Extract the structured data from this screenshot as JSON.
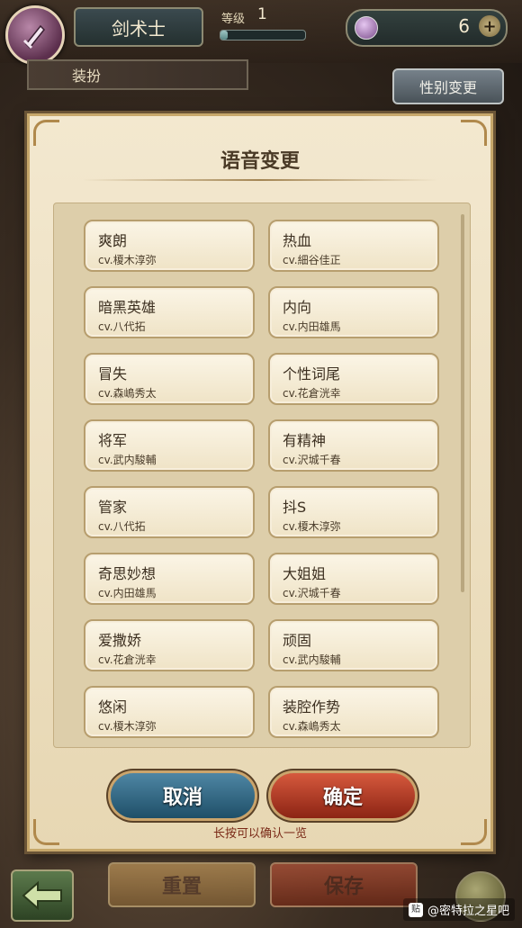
{
  "header": {
    "class_name": "剑术士",
    "level_label": "等级",
    "level_value": "1",
    "level_progress": 0.08,
    "gem_count": "6"
  },
  "outfit_tab": {
    "label": "装扮"
  },
  "gender_button": {
    "label": "性别变更"
  },
  "dialog": {
    "title": "语音变更",
    "voices": [
      {
        "name": "爽朗",
        "cv": "cv.榎木淳弥"
      },
      {
        "name": "热血",
        "cv": "cv.細谷佳正"
      },
      {
        "name": "暗黑英雄",
        "cv": "cv.八代拓"
      },
      {
        "name": "内向",
        "cv": "cv.内田雄馬"
      },
      {
        "name": "冒失",
        "cv": "cv.森嶋秀太"
      },
      {
        "name": "个性词尾",
        "cv": "cv.花倉洸幸"
      },
      {
        "name": "将军",
        "cv": "cv.武内駿輔"
      },
      {
        "name": "有精神",
        "cv": "cv.沢城千春"
      },
      {
        "name": "管家",
        "cv": "cv.八代拓"
      },
      {
        "name": "抖S",
        "cv": "cv.榎木淳弥"
      },
      {
        "name": "奇思妙想",
        "cv": "cv.内田雄馬"
      },
      {
        "name": "大姐姐",
        "cv": "cv.沢城千春"
      },
      {
        "name": "爱撒娇",
        "cv": "cv.花倉洸幸"
      },
      {
        "name": "顽固",
        "cv": "cv.武内駿輔"
      },
      {
        "name": "悠闲",
        "cv": "cv.榎木淳弥"
      },
      {
        "name": "装腔作势",
        "cv": "cv.森嶋秀太"
      }
    ],
    "cancel_label": "取消",
    "confirm_label": "确定",
    "hint": "长按可以确认一览"
  },
  "bottom": {
    "reset_label": "重置",
    "save_label": "保存"
  },
  "watermark": {
    "icon_text": "贴",
    "text": "@密特拉之星吧"
  },
  "icons": {
    "class_badge": "sword-emblem-icon",
    "gem": "gem-icon",
    "plus": "plus-icon",
    "back": "back-arrow-icon",
    "globe": "globe-icon"
  }
}
